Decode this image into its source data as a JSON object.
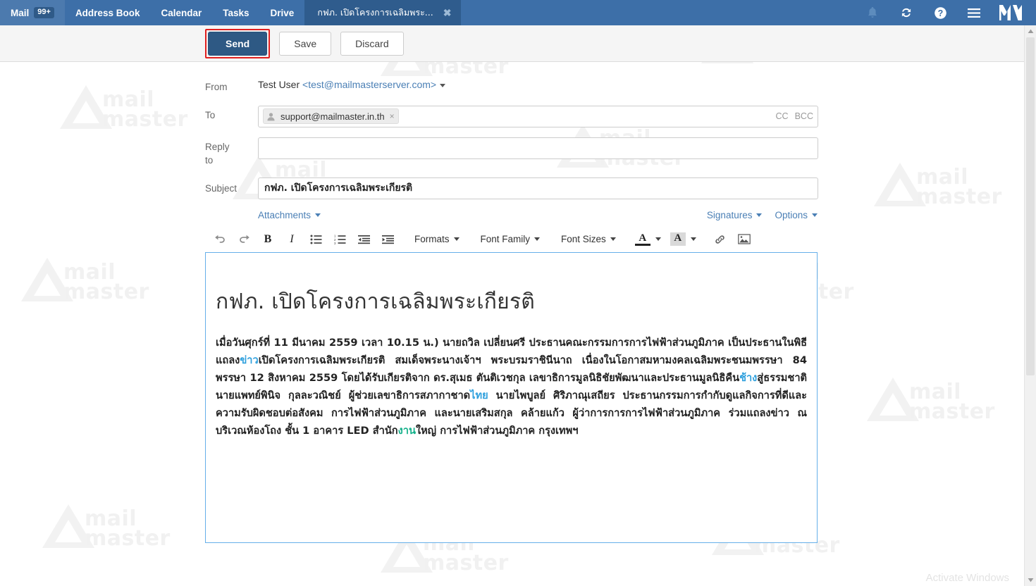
{
  "topbar": {
    "nav_items": [
      {
        "label": "Mail",
        "badge": "99+",
        "name": "nav-mail"
      },
      {
        "label": "Address Book",
        "badge": "",
        "name": "nav-address-book"
      },
      {
        "label": "Calendar",
        "badge": "",
        "name": "nav-calendar"
      },
      {
        "label": "Tasks",
        "badge": "",
        "name": "nav-tasks"
      },
      {
        "label": "Drive",
        "badge": "",
        "name": "nav-drive"
      }
    ],
    "active_tab": "กฟภ. เปิดโครงการเฉลิมพระ...",
    "close_glyph": "✖",
    "icons": [
      {
        "name": "bell-icon",
        "title": "Notifications"
      },
      {
        "name": "refresh-icon",
        "title": "Refresh"
      },
      {
        "name": "help-icon",
        "title": "Help"
      },
      {
        "name": "hamburger-menu-icon",
        "title": "Menu"
      }
    ],
    "logo_text": "M",
    "background_color": "#3d6fa8",
    "tab_background_color": "#2f5c8d"
  },
  "actionbar": {
    "send_label": "Send",
    "save_label": "Save",
    "discard_label": "Discard",
    "send_highlight_color": "#e02020",
    "send_background_color": "#2e5984"
  },
  "compose": {
    "from": {
      "label": "From",
      "display_name": "Test User ",
      "email": "<test@mailmasterserver.com>"
    },
    "to": {
      "label": "To",
      "recipient": "support@mailmaster.in.th",
      "chip_remove_glyph": "×",
      "cc_label": "CC",
      "bcc_label": "BCC"
    },
    "reply_to": {
      "label_line1": "Reply",
      "label_line2": "to",
      "value": "",
      "placeholder": ""
    },
    "subject": {
      "label": "Subject",
      "value": "กฟภ. เปิดโครงการเฉลิมพระเกียรติ",
      "placeholder": ""
    },
    "attachments_label": "Attachments",
    "signatures_label": "Signatures",
    "options_label": "Options"
  },
  "editor": {
    "toolbar": {
      "undo": "undo-icon",
      "redo": "redo-icon",
      "bold": "B",
      "italic": "I",
      "bullet_list": "bullet-list-icon",
      "numbered_list": "numbered-list-icon",
      "outdent": "outdent-icon",
      "indent": "indent-icon",
      "formats_label": "Formats",
      "font_family_label": "Font Family",
      "font_sizes_label": "Font Sizes",
      "text_color_glyph": "A",
      "background_color_glyph": "A",
      "link": "link-icon",
      "image": "image-icon"
    },
    "border_color": "#66afe9",
    "content": {
      "heading": "กฟภ. เปิดโครงการเฉลิมพระเกียรติ",
      "paragraph_parts": [
        {
          "text": "เมื่อวันศุกร์ที่ 11 มีนาคม 2559 เวลา 10.15 น.) นายถวิล เปลี่ยนศรี ประธานคณะกรรมการการไฟฟ้าส่วนภูมิภาค เป็นประธานในพิธีแถลง",
          "type": "text"
        },
        {
          "text": "ข่าว",
          "type": "link-blue"
        },
        {
          "text": "เปิดโครงการเฉลิมพระเกียรติ สมเด็จพระนางเจ้าฯ พระบรมราชินีนาถ เนื่องในโอกาสมหามงคลเฉลิมพระชนมพรรษา 84 พรรษา 12 สิงหาคม 2559 โดยได้รับเกียรติจาก ดร.สุเมธ ตันติเวชกุล เลขาธิการมูลนิธิชัยพัฒนาและประธานมูลนิธิคืน",
          "type": "text"
        },
        {
          "text": "ช้าง",
          "type": "link-blue"
        },
        {
          "text": "สู่ธรรมชาติ นายแพทย์พินิจ กุลละวณิชย์ ผู้ช่วยเลขาธิการสภากาชาด",
          "type": "text"
        },
        {
          "text": "ไทย",
          "type": "link-blue"
        },
        {
          "text": " นายไพบูลย์ ศิริภาณุเสถียร ประธานกรรมการกำกับดูแลกิจการที่ดีและความรับผิดชอบต่อสังคม การไฟฟ้าส่วนภูมิภาค และนายเสริมสกุล คล้ายแก้ว ผู้ว่าการการการไฟฟ้าส่วนภูมิภาค ร่วมแถลงข่าว ณ บริเวณห้องโถง ชั้น 1 อาคาร LED สำนัก",
          "type": "text"
        },
        {
          "text": "งาน",
          "type": "link-green"
        },
        {
          "text": "ใหญ่ การไฟฟ้าส่วนภูมิภาค กรุงเทพฯ",
          "type": "text"
        }
      ],
      "link_blue_color": "#2fa0dd",
      "link_green_color": "#13b08a"
    }
  },
  "watermark": {
    "brand_line1": "mail",
    "brand_line2": "master",
    "windows_notice": "Activate Windows"
  }
}
